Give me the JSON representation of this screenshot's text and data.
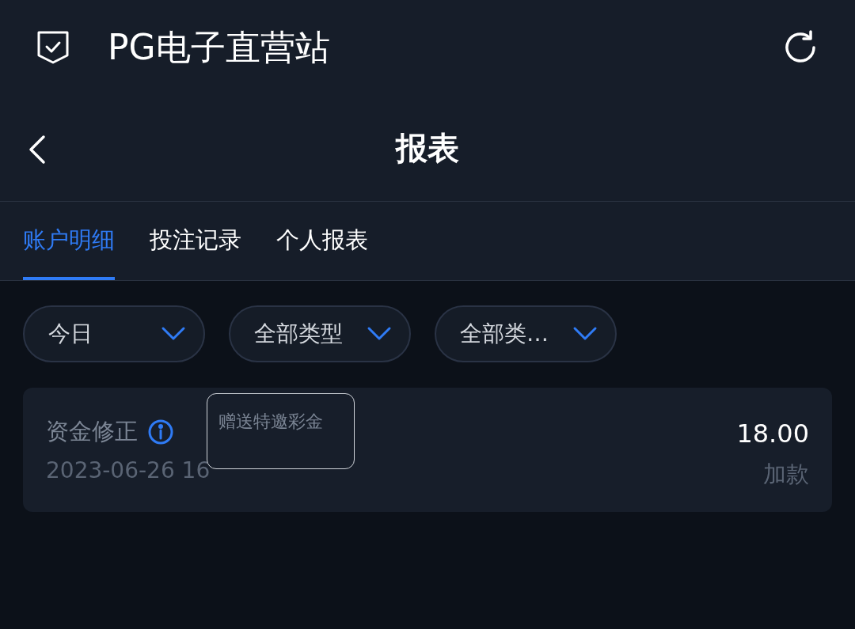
{
  "app_bar": {
    "title": "PG电子直营站"
  },
  "page_header": {
    "title": "报表"
  },
  "tabs": [
    {
      "label": "账户明细",
      "selected": true
    },
    {
      "label": "投注记录",
      "selected": false
    },
    {
      "label": "个人报表",
      "selected": false
    }
  ],
  "filters": [
    {
      "value": "今日"
    },
    {
      "value": "全部类型"
    },
    {
      "value": "全部类…"
    }
  ],
  "records": [
    {
      "type": "资金修正",
      "time": "2023-06-26 16",
      "amount": "18.00",
      "direction": "加款",
      "tooltip": "赠送特邀彩金"
    }
  ]
}
